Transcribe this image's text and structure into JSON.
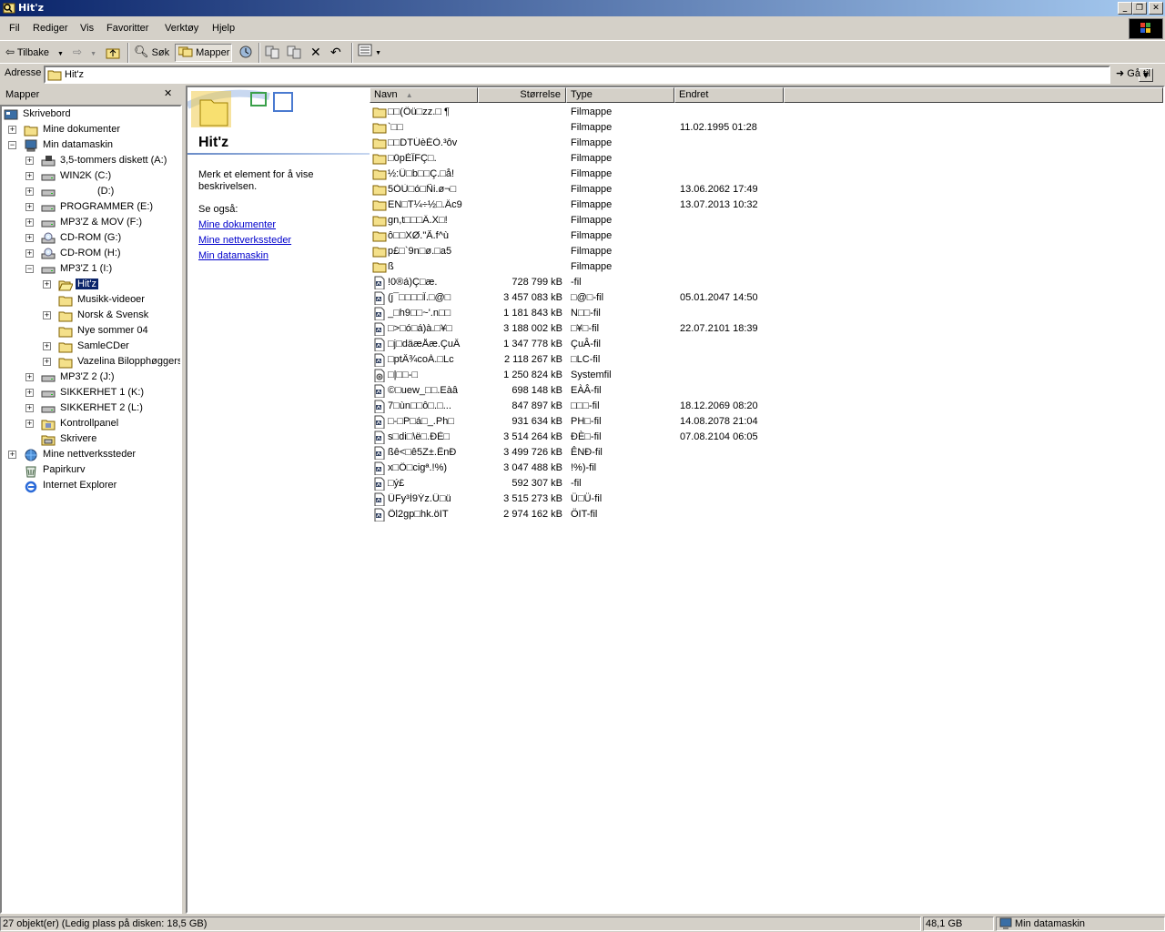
{
  "window": {
    "title": "Hit'z"
  },
  "menu": [
    "Fil",
    "Rediger",
    "Vis",
    "Favoritter",
    "Verktøy",
    "Hjelp"
  ],
  "toolbar": {
    "back": "Tilbake",
    "search": "Søk",
    "folders": "Mapper"
  },
  "address": {
    "label": "Adresse",
    "value": "Hit'z",
    "go": "Gå til"
  },
  "folders_pane": {
    "title": "Mapper",
    "close": "✕",
    "tree": [
      {
        "label": "Skrivebord",
        "icon": "desktop-icon",
        "expander": ""
      },
      {
        "label": "Mine dokumenter",
        "icon": "folder-icon",
        "expander": "+"
      },
      {
        "label": "Min datamaskin",
        "icon": "computer-icon",
        "expander": "-"
      },
      {
        "label": "3,5-tommers diskett (A:)",
        "icon": "floppy-drive-icon",
        "expander": "+"
      },
      {
        "label": "WIN2K (C:)",
        "icon": "hard-drive-icon",
        "expander": "+"
      },
      {
        "label": "(D:)",
        "icon": "hard-drive-icon",
        "expander": "+"
      },
      {
        "label": "PROGRAMMER (E:)",
        "icon": "hard-drive-icon",
        "expander": "+"
      },
      {
        "label": "MP3'Z & MOV (F:)",
        "icon": "hard-drive-icon",
        "expander": "+"
      },
      {
        "label": "CD-ROM (G:)",
        "icon": "cd-drive-icon",
        "expander": "+"
      },
      {
        "label": "CD-ROM (H:)",
        "icon": "cd-drive-icon",
        "expander": "+"
      },
      {
        "label": "MP3'Z 1 (I:)",
        "icon": "hard-drive-icon",
        "expander": "-"
      },
      {
        "label": "Hit'z",
        "icon": "open-folder-icon",
        "expander": "+"
      },
      {
        "label": "Musikk-videoer",
        "icon": "folder-icon",
        "expander": ""
      },
      {
        "label": "Norsk & Svensk",
        "icon": "folder-icon",
        "expander": "+"
      },
      {
        "label": "Nye sommer 04",
        "icon": "folder-icon",
        "expander": ""
      },
      {
        "label": "SamleCDer",
        "icon": "folder-icon",
        "expander": "+"
      },
      {
        "label": "Vazelina Bilopphøggers",
        "icon": "folder-icon",
        "expander": "+"
      },
      {
        "label": "MP3'Z 2 (J:)",
        "icon": "hard-drive-icon",
        "expander": "+"
      },
      {
        "label": "SIKKERHET 1 (K:)",
        "icon": "hard-drive-icon",
        "expander": "+"
      },
      {
        "label": "SIKKERHET 2 (L:)",
        "icon": "hard-drive-icon",
        "expander": "+"
      },
      {
        "label": "Kontrollpanel",
        "icon": "control-panel-icon",
        "expander": "+"
      },
      {
        "label": "Skrivere",
        "icon": "printer-folder-icon",
        "expander": ""
      },
      {
        "label": "Mine nettverkssteder",
        "icon": "network-icon",
        "expander": "+"
      },
      {
        "label": "Papirkurv",
        "icon": "recycle-bin-icon",
        "expander": ""
      },
      {
        "label": "Internet Explorer",
        "icon": "ie-icon",
        "expander": ""
      }
    ]
  },
  "web_panel": {
    "title": "Hit'z",
    "description": "Merk et element for å vise beskrivelsen.",
    "see_also": "Se også:",
    "links": [
      "Mine dokumenter",
      "Mine nettverkssteder",
      "Min datamaskin"
    ]
  },
  "columns": {
    "name": "Navn",
    "size": "Størrelse",
    "type": "Type",
    "modified": "Endret"
  },
  "files": [
    {
      "name": "□□(Ôü□zz.□ ¶",
      "size": "",
      "type": "Filmappe",
      "modified": "",
      "icon": "folder-icon"
    },
    {
      "name": "`□□",
      "size": "",
      "type": "Filmappe",
      "modified": "11.02.1995 01:28",
      "icon": "folder-icon"
    },
    {
      "name": "□□DTÚèÉÒ.³ôv",
      "size": "",
      "type": "Filmappe",
      "modified": "",
      "icon": "folder-icon"
    },
    {
      "name": "□0pÉÎFÇ□.",
      "size": "",
      "type": "Filmappe",
      "modified": "",
      "icon": "folder-icon"
    },
    {
      "name": "½:Ü□b□□Ç.□å!",
      "size": "",
      "type": "Filmappe",
      "modified": "",
      "icon": "folder-icon"
    },
    {
      "name": "5ÒÙ□ó□Ñi.ø¬□",
      "size": "",
      "type": "Filmappe",
      "modified": "13.06.2062 17:49",
      "icon": "folder-icon"
    },
    {
      "name": "EN□T¼÷½□.Äc9",
      "size": "",
      "type": "Filmappe",
      "modified": "13.07.2013 10:32",
      "icon": "folder-icon"
    },
    {
      "name": "gn,t□□□Ä.X□!",
      "size": "",
      "type": "Filmappe",
      "modified": "",
      "icon": "folder-icon"
    },
    {
      "name": "ô□□XØ.\"Ã.f^ù",
      "size": "",
      "type": "Filmappe",
      "modified": "",
      "icon": "folder-icon"
    },
    {
      "name": "p£□`9n□ø.□a5",
      "size": "",
      "type": "Filmappe",
      "modified": "",
      "icon": "folder-icon"
    },
    {
      "name": "ß",
      "size": "",
      "type": "Filmappe",
      "modified": "",
      "icon": "folder-icon"
    },
    {
      "name": "!0®á)Ç□æ.",
      "size": "728 799 kB",
      "type": "-fil",
      "modified": "",
      "icon": "file-icon"
    },
    {
      "name": "(j¯□□□□Î.□@□",
      "size": "3 457 083 kB",
      "type": "□@□-fil",
      "modified": "05.01.2047 14:50",
      "icon": "file-icon"
    },
    {
      "name": "_□h9□□~'.n□□",
      "size": "1 181 843 kB",
      "type": "N□□-fil",
      "modified": "",
      "icon": "file-icon"
    },
    {
      "name": "□>□ó□á)à.□¥□",
      "size": "3 188 002 kB",
      "type": "□¥□-fil",
      "modified": "22.07.2101 18:39",
      "icon": "file-icon"
    },
    {
      "name": "□j□däæÅæ.ÇuÂ",
      "size": "1 347 778 kB",
      "type": "ÇuÂ-fil",
      "modified": "",
      "icon": "file-icon"
    },
    {
      "name": "□ptÂ¾coÁ.□Lc",
      "size": "2 118 267 kB",
      "type": "□LC-fil",
      "modified": "",
      "icon": "file-icon"
    },
    {
      "name": "□|□□-□",
      "size": "1 250 824 kB",
      "type": "Systemfil",
      "modified": "",
      "icon": "system-file-icon"
    },
    {
      "name": "©□uew_□□.Eàâ",
      "size": "698 148 kB",
      "type": "EÀÂ-fil",
      "modified": "",
      "icon": "file-icon"
    },
    {
      "name": "7□ùn□□ô□.□...",
      "size": "847 897 kB",
      "type": "□□□-fil",
      "modified": "18.12.2069 08:20",
      "icon": "file-icon"
    },
    {
      "name": "□-□P□á□_.Ph□",
      "size": "931 634 kB",
      "type": "PH□-fil",
      "modified": "14.08.2078 21:04",
      "icon": "file-icon"
    },
    {
      "name": "s□di□\\ë□.ÐÈ□",
      "size": "3 514 264 kB",
      "type": "ÐÈ□-fil",
      "modified": "07.08.2104 06:05",
      "icon": "file-icon"
    },
    {
      "name": "ßê<□ê5Z±.ÊnÐ",
      "size": "3 499 726 kB",
      "type": "ÊNÐ-fil",
      "modified": "",
      "icon": "file-icon"
    },
    {
      "name": "x□Ô□cigª.!%)",
      "size": "3 047 488 kB",
      "type": "!%)-fil",
      "modified": "",
      "icon": "file-icon"
    },
    {
      "name": "□ý£",
      "size": "592 307 kB",
      "type": "-fil",
      "modified": "",
      "icon": "file-icon"
    },
    {
      "name": "ÜFy³Ì9Ýz.Ü□ü",
      "size": "3 515 273 kB",
      "type": "Ü□Ü-fil",
      "modified": "",
      "icon": "file-icon"
    },
    {
      "name": "Öl2gp□hk.öIT",
      "size": "2 974 162 kB",
      "type": "ÖIT-fil",
      "modified": "",
      "icon": "file-icon"
    }
  ],
  "status": {
    "objects": "27 objekt(er) (Ledig plass på disken: 18,5 GB)",
    "size": "48,1 GB",
    "zone": "Min datamaskin"
  }
}
